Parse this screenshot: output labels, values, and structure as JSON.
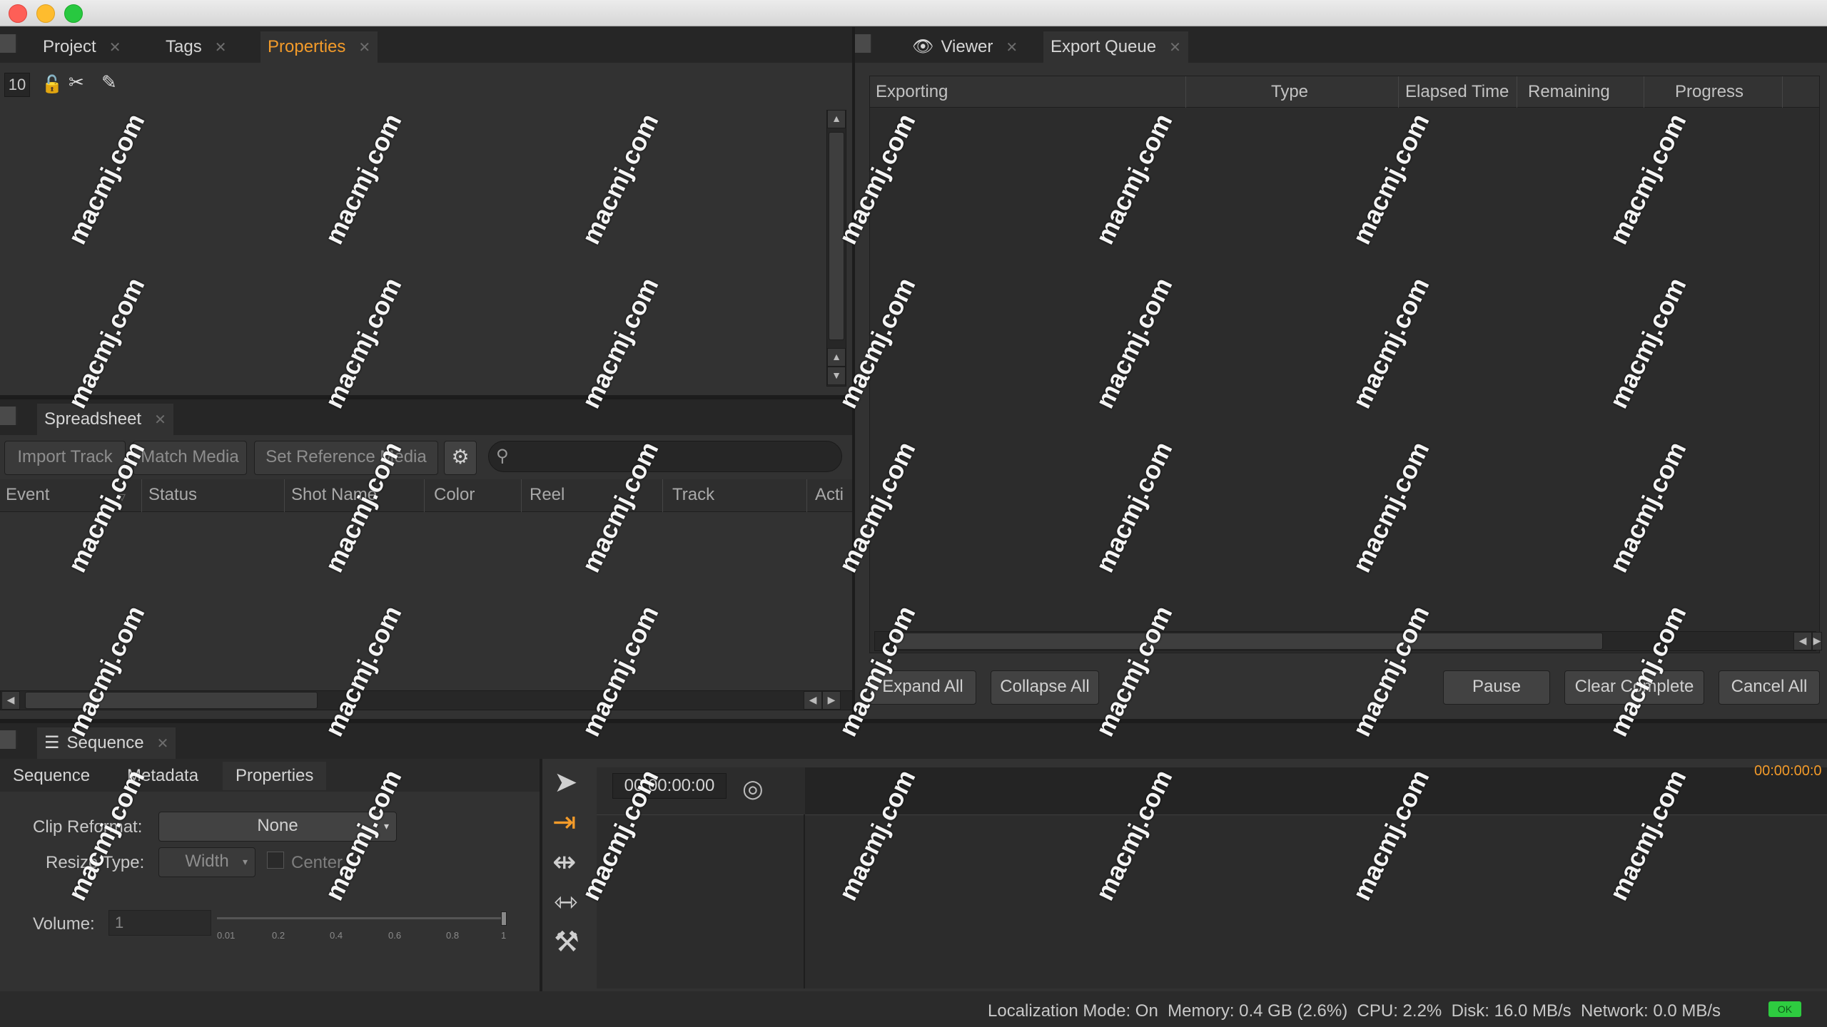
{
  "project_panel": {
    "tabs": [
      {
        "label": "Project"
      },
      {
        "label": "Tags"
      },
      {
        "label": "Properties"
      }
    ],
    "toolbar_count": "10"
  },
  "viewer_panel": {
    "tabs": [
      {
        "label": "Viewer"
      },
      {
        "label": "Export Queue"
      }
    ],
    "columns": [
      "Exporting",
      "Type",
      "Elapsed Time",
      "Remaining",
      "Progress"
    ],
    "buttons": {
      "expand_all": "Expand All",
      "collapse_all": "Collapse All",
      "pause": "Pause",
      "clear_complete": "Clear Complete",
      "cancel_all": "Cancel All"
    }
  },
  "spreadsheet_panel": {
    "tab": "Spreadsheet",
    "buttons": {
      "import_track": "Import Track",
      "match_media": "Match Media",
      "set_reference_media": "Set Reference Media"
    },
    "search_placeholder": "",
    "columns": [
      "Event",
      "Status",
      "Shot Name",
      "Color",
      "Reel",
      "Track",
      "Acti"
    ]
  },
  "sequence_panel": {
    "tab": "Sequence",
    "subtabs": [
      "Sequence",
      "Metadata",
      "Properties"
    ],
    "clip_reformat_label": "Clip Reformat:",
    "clip_reformat_value": "None",
    "resize_type_label": "Resize Type:",
    "resize_type_value": "Width",
    "center_label": "Center",
    "volume_label": "Volume:",
    "volume_value": "1",
    "volume_ticks": [
      "0.01",
      "0.2",
      "0.4",
      "0.6",
      "0.8",
      "1"
    ],
    "timecode": "00:00:00:00",
    "timeline_timecode": "00:00:00:0"
  },
  "status_bar": {
    "text": "Localization Mode: On  Memory: 0.4 GB (2.6%)  CPU: 2.2%  Disk: 16.0 MB/s  Network: 0.0 MB/s",
    "ok": "OK"
  },
  "watermark": "macmj.com",
  "colors": {
    "accent_orange": "#f39b2a",
    "ok_green": "#2ecc40"
  }
}
